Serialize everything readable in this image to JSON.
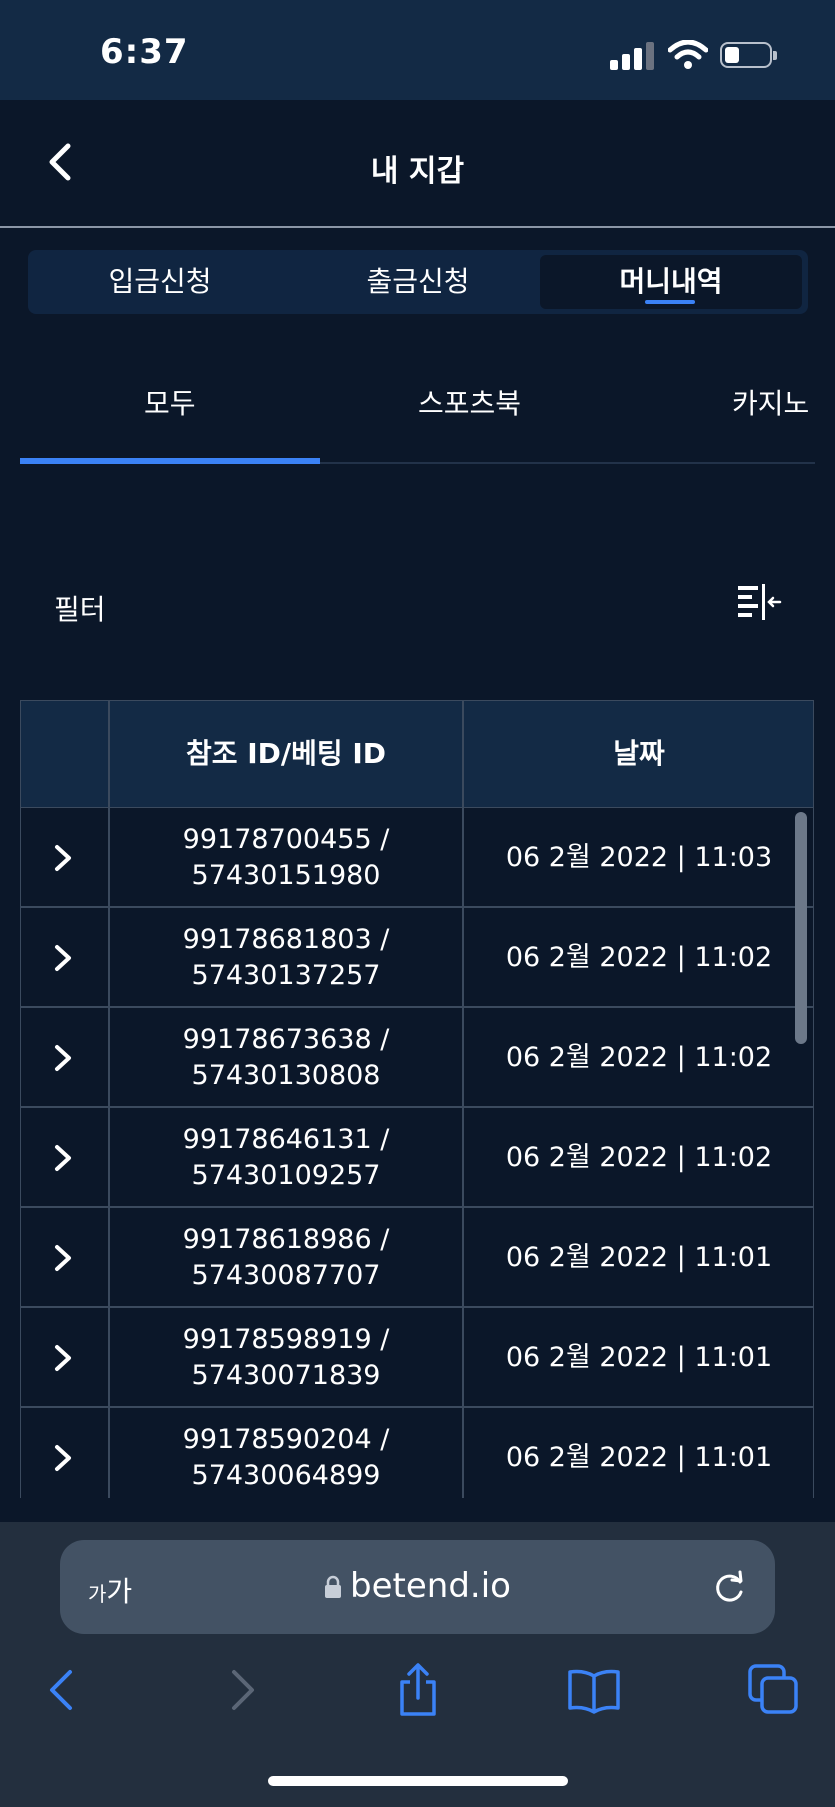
{
  "status": {
    "time": "6:37"
  },
  "header": {
    "title": "내 지갑"
  },
  "segments": [
    {
      "label": "입금신청",
      "active": false
    },
    {
      "label": "출금신청",
      "active": false
    },
    {
      "label": "머니내역",
      "active": true
    }
  ],
  "categories": [
    {
      "label": "모두",
      "active": true
    },
    {
      "label": "스포츠북",
      "active": false
    },
    {
      "label": "카지노",
      "active": false
    }
  ],
  "filter": {
    "label": "필터"
  },
  "table": {
    "headers": [
      "참조 ID/베팅 ID",
      "날짜"
    ],
    "rows": [
      {
        "ref": "99178700455 /",
        "bet": "57430151980",
        "date": "06 2월 2022 | 11:03"
      },
      {
        "ref": "99178681803 /",
        "bet": "57430137257",
        "date": "06 2월 2022 | 11:02"
      },
      {
        "ref": "99178673638 /",
        "bet": "57430130808",
        "date": "06 2월 2022 | 11:02"
      },
      {
        "ref": "99178646131 /",
        "bet": "57430109257",
        "date": "06 2월 2022 | 11:02"
      },
      {
        "ref": "99178618986 /",
        "bet": "57430087707",
        "date": "06 2월 2022 | 11:01"
      },
      {
        "ref": "99178598919 /",
        "bet": "57430071839",
        "date": "06 2월 2022 | 11:01"
      },
      {
        "ref": "99178590204 /",
        "bet": "57430064899",
        "date": "06 2월 2022 | 11:01"
      }
    ]
  },
  "browser": {
    "text_size_small": "가",
    "text_size_large": "가",
    "url": "betend.io"
  },
  "colors": {
    "background": "#0b1729",
    "accent": "#3b82f6",
    "header_cell": "#132a45",
    "browser_bar": "#232f3e",
    "browser_icon": "#3b82f6"
  },
  "icons": [
    "back-chevron-icon",
    "filter-sort-icon",
    "row-expand-chevron-icon",
    "lock-icon",
    "reload-icon",
    "browser-back-icon",
    "browser-forward-icon",
    "share-icon",
    "bookmarks-icon",
    "tabs-icon"
  ]
}
